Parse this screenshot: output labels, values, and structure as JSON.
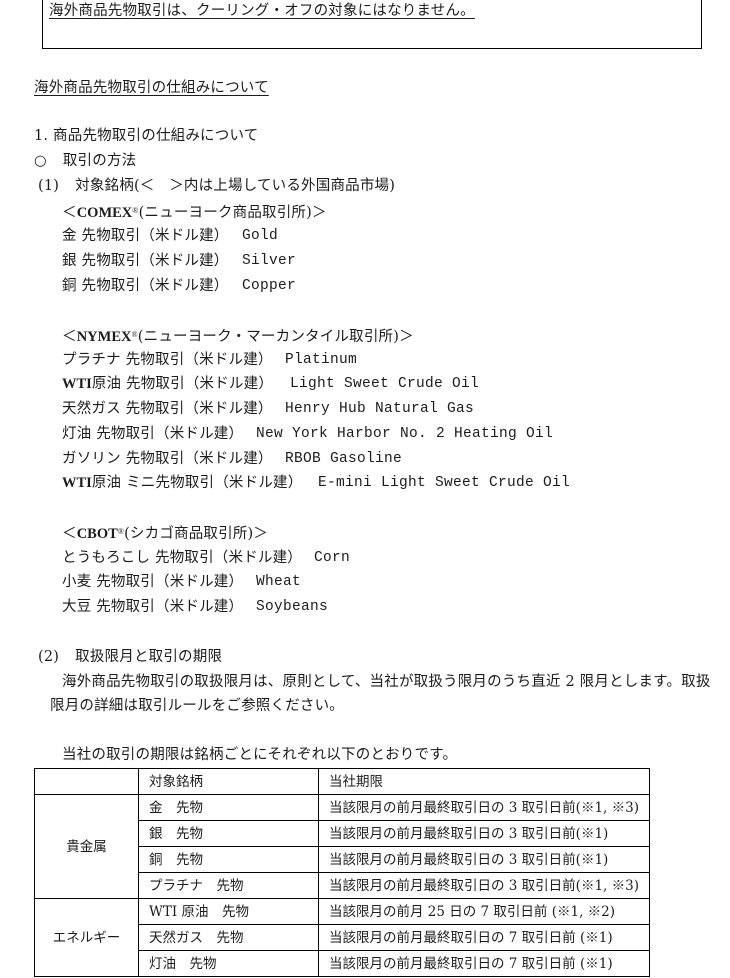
{
  "notice": {
    "text": "海外商品先物取引は、クーリング・オフの対象にはなりません。"
  },
  "heading": "海外商品先物取引の仕組みについて",
  "section1": {
    "title": "1. 商品先物取引の仕組みについて",
    "bullet_symbol": "○",
    "bullet_text": "取引の方法"
  },
  "item1": {
    "number": "(1)",
    "title": "対象銘柄(＜　＞内は上場している外国商品市場)"
  },
  "exchanges": [
    {
      "open": "＜",
      "name": "COMEX",
      "mark": "®",
      "desc": "(ニューヨーク商品取引所)",
      "close": "＞",
      "products": [
        {
          "jp": "金 先物取引（米ドル建）",
          "en": "Gold"
        },
        {
          "jp": "銀 先物取引（米ドル建）",
          "en": "Silver"
        },
        {
          "jp": "銅 先物取引（米ドル建）",
          "en": "Copper"
        }
      ]
    },
    {
      "open": "＜",
      "name": "NYMEX",
      "mark": "®",
      "desc": "(ニューヨーク・マーカンタイル取引所)",
      "close": "＞",
      "products": [
        {
          "prefix": "",
          "jp": "プラチナ 先物取引（米ドル建）",
          "en": "Platinum"
        },
        {
          "prefix": "WTI",
          "jp": "原油 先物取引（米ドル建）",
          "en": "Light Sweet Crude Oil"
        },
        {
          "prefix": "",
          "jp": "天然ガス 先物取引（米ドル建）",
          "en": "Henry Hub Natural Gas"
        },
        {
          "prefix": "",
          "jp": "灯油 先物取引（米ドル建）",
          "en": "New York Harbor No. 2 Heating Oil"
        },
        {
          "prefix": "",
          "jp": "ガソリン 先物取引（米ドル建）",
          "en": "RBOB Gasoline"
        },
        {
          "prefix": "WTI",
          "jp": "原油 ミニ先物取引（米ドル建）",
          "en": "E-mini Light Sweet Crude Oil"
        }
      ]
    },
    {
      "open": "＜",
      "name": "CBOT",
      "mark": "®",
      "desc": "(シカゴ商品取引所)",
      "close": "＞",
      "products": [
        {
          "jp": "とうもろこし 先物取引（米ドル建）",
          "en": "Corn"
        },
        {
          "jp": "小麦 先物取引（米ドル建）",
          "en": "Wheat"
        },
        {
          "jp": "大豆 先物取引（米ドル建）",
          "en": "Soybeans"
        }
      ]
    }
  ],
  "item2": {
    "number": "(2)",
    "title": "取扱限月と取引の期限",
    "paragraph_lines": [
      "海外商品先物取引の取扱限月は、原則として、当社が取扱う限月のうち直近 2 限月とします。取扱",
      "限月の詳細は取引ルールをご参照ください。"
    ],
    "table_intro": "当社の取引の期限は銘柄ごとにそれぞれ以下のとおりです。"
  },
  "table": {
    "headers": [
      "",
      "対象銘柄",
      "当社期限"
    ],
    "groups": [
      {
        "category": "貴金属",
        "rows": [
          {
            "product": "金　先物",
            "deadline": "当該限月の前月最終取引日の 3 取引日前(※1, ※3)"
          },
          {
            "product": "銀　先物",
            "deadline": "当該限月の前月最終取引日の 3 取引日前(※1)"
          },
          {
            "product": "銅　先物",
            "deadline": "当該限月の前月最終取引日の 3 取引日前(※1)"
          },
          {
            "product": "プラチナ　先物",
            "deadline": "当該限月の前月最終取引日の 3 取引日前(※1, ※3)"
          }
        ]
      },
      {
        "category": "エネルギー",
        "rows": [
          {
            "product": "WTI 原油　先物",
            "deadline": "当該限月の前月 25 日の 7 取引日前 (※1, ※2)"
          },
          {
            "product": "天然ガス　先物",
            "deadline": "当該限月の前月最終取引日の 7 取引日前 (※1)"
          },
          {
            "product": "灯油　先物",
            "deadline": "当該限月の前月最終取引日の 7 取引日前 (※1)"
          }
        ]
      }
    ]
  }
}
